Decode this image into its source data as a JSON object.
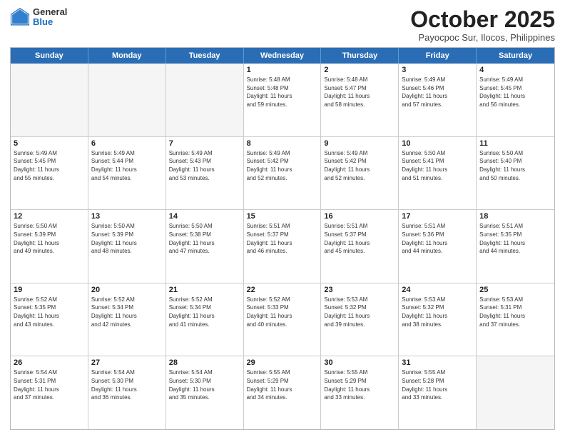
{
  "header": {
    "logo_general": "General",
    "logo_blue": "Blue",
    "month_title": "October 2025",
    "location": "Payocpoc Sur, Ilocos, Philippines"
  },
  "weekdays": [
    "Sunday",
    "Monday",
    "Tuesday",
    "Wednesday",
    "Thursday",
    "Friday",
    "Saturday"
  ],
  "rows": [
    [
      {
        "day": "",
        "info": ""
      },
      {
        "day": "",
        "info": ""
      },
      {
        "day": "",
        "info": ""
      },
      {
        "day": "1",
        "info": "Sunrise: 5:48 AM\nSunset: 5:48 PM\nDaylight: 11 hours\nand 59 minutes."
      },
      {
        "day": "2",
        "info": "Sunrise: 5:48 AM\nSunset: 5:47 PM\nDaylight: 11 hours\nand 58 minutes."
      },
      {
        "day": "3",
        "info": "Sunrise: 5:49 AM\nSunset: 5:46 PM\nDaylight: 11 hours\nand 57 minutes."
      },
      {
        "day": "4",
        "info": "Sunrise: 5:49 AM\nSunset: 5:45 PM\nDaylight: 11 hours\nand 56 minutes."
      }
    ],
    [
      {
        "day": "5",
        "info": "Sunrise: 5:49 AM\nSunset: 5:45 PM\nDaylight: 11 hours\nand 55 minutes."
      },
      {
        "day": "6",
        "info": "Sunrise: 5:49 AM\nSunset: 5:44 PM\nDaylight: 11 hours\nand 54 minutes."
      },
      {
        "day": "7",
        "info": "Sunrise: 5:49 AM\nSunset: 5:43 PM\nDaylight: 11 hours\nand 53 minutes."
      },
      {
        "day": "8",
        "info": "Sunrise: 5:49 AM\nSunset: 5:42 PM\nDaylight: 11 hours\nand 52 minutes."
      },
      {
        "day": "9",
        "info": "Sunrise: 5:49 AM\nSunset: 5:42 PM\nDaylight: 11 hours\nand 52 minutes."
      },
      {
        "day": "10",
        "info": "Sunrise: 5:50 AM\nSunset: 5:41 PM\nDaylight: 11 hours\nand 51 minutes."
      },
      {
        "day": "11",
        "info": "Sunrise: 5:50 AM\nSunset: 5:40 PM\nDaylight: 11 hours\nand 50 minutes."
      }
    ],
    [
      {
        "day": "12",
        "info": "Sunrise: 5:50 AM\nSunset: 5:39 PM\nDaylight: 11 hours\nand 49 minutes."
      },
      {
        "day": "13",
        "info": "Sunrise: 5:50 AM\nSunset: 5:39 PM\nDaylight: 11 hours\nand 48 minutes."
      },
      {
        "day": "14",
        "info": "Sunrise: 5:50 AM\nSunset: 5:38 PM\nDaylight: 11 hours\nand 47 minutes."
      },
      {
        "day": "15",
        "info": "Sunrise: 5:51 AM\nSunset: 5:37 PM\nDaylight: 11 hours\nand 46 minutes."
      },
      {
        "day": "16",
        "info": "Sunrise: 5:51 AM\nSunset: 5:37 PM\nDaylight: 11 hours\nand 45 minutes."
      },
      {
        "day": "17",
        "info": "Sunrise: 5:51 AM\nSunset: 5:36 PM\nDaylight: 11 hours\nand 44 minutes."
      },
      {
        "day": "18",
        "info": "Sunrise: 5:51 AM\nSunset: 5:35 PM\nDaylight: 11 hours\nand 44 minutes."
      }
    ],
    [
      {
        "day": "19",
        "info": "Sunrise: 5:52 AM\nSunset: 5:35 PM\nDaylight: 11 hours\nand 43 minutes."
      },
      {
        "day": "20",
        "info": "Sunrise: 5:52 AM\nSunset: 5:34 PM\nDaylight: 11 hours\nand 42 minutes."
      },
      {
        "day": "21",
        "info": "Sunrise: 5:52 AM\nSunset: 5:34 PM\nDaylight: 11 hours\nand 41 minutes."
      },
      {
        "day": "22",
        "info": "Sunrise: 5:52 AM\nSunset: 5:33 PM\nDaylight: 11 hours\nand 40 minutes."
      },
      {
        "day": "23",
        "info": "Sunrise: 5:53 AM\nSunset: 5:32 PM\nDaylight: 11 hours\nand 39 minutes."
      },
      {
        "day": "24",
        "info": "Sunrise: 5:53 AM\nSunset: 5:32 PM\nDaylight: 11 hours\nand 38 minutes."
      },
      {
        "day": "25",
        "info": "Sunrise: 5:53 AM\nSunset: 5:31 PM\nDaylight: 11 hours\nand 37 minutes."
      }
    ],
    [
      {
        "day": "26",
        "info": "Sunrise: 5:54 AM\nSunset: 5:31 PM\nDaylight: 11 hours\nand 37 minutes."
      },
      {
        "day": "27",
        "info": "Sunrise: 5:54 AM\nSunset: 5:30 PM\nDaylight: 11 hours\nand 36 minutes."
      },
      {
        "day": "28",
        "info": "Sunrise: 5:54 AM\nSunset: 5:30 PM\nDaylight: 11 hours\nand 35 minutes."
      },
      {
        "day": "29",
        "info": "Sunrise: 5:55 AM\nSunset: 5:29 PM\nDaylight: 11 hours\nand 34 minutes."
      },
      {
        "day": "30",
        "info": "Sunrise: 5:55 AM\nSunset: 5:29 PM\nDaylight: 11 hours\nand 33 minutes."
      },
      {
        "day": "31",
        "info": "Sunrise: 5:55 AM\nSunset: 5:28 PM\nDaylight: 11 hours\nand 33 minutes."
      },
      {
        "day": "",
        "info": ""
      }
    ]
  ]
}
